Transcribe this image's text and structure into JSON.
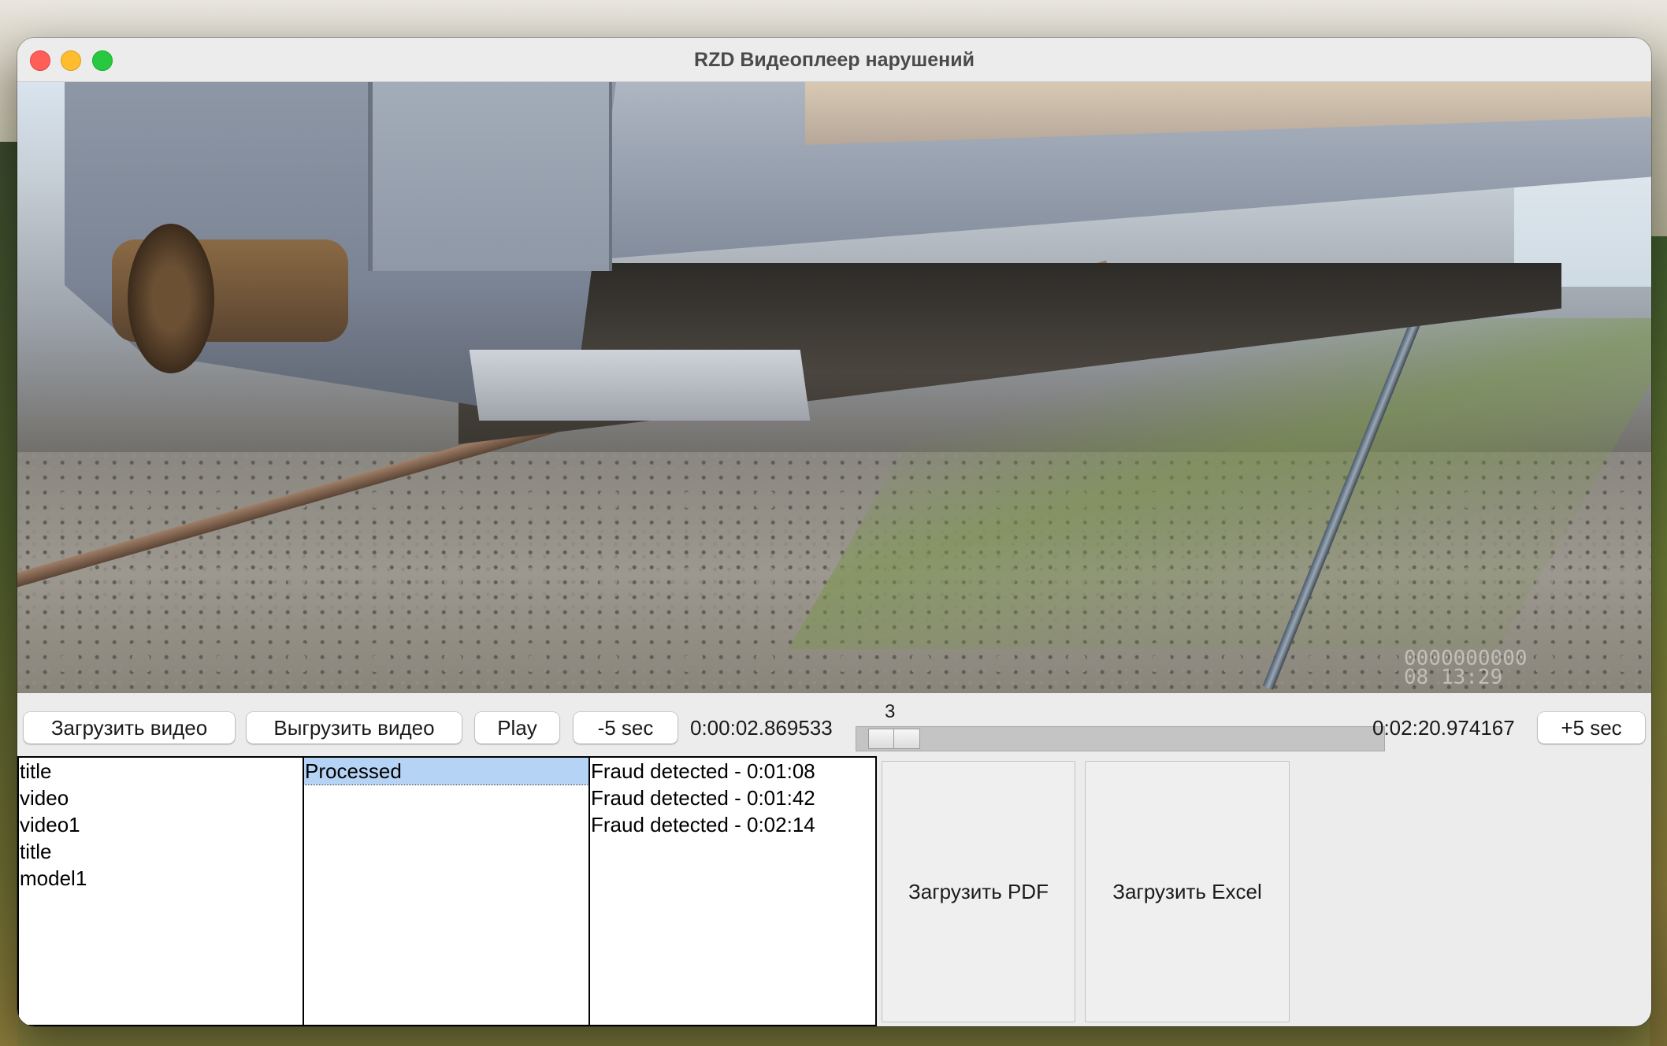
{
  "window": {
    "title": "RZD Видеоплеер нарушений"
  },
  "video": {
    "overlay_text_line1": "0000000000",
    "overlay_text_line2": "08 13:29"
  },
  "controls": {
    "load_video_label": "Загрузить видео",
    "unload_video_label": "Выгрузить видео",
    "play_label": "Play",
    "back_label": "-5 sec",
    "current_time": "0:00:02.869533",
    "slider_value": "3",
    "slider_fraction": 0.021,
    "total_time": "0:02:20.974167",
    "forward_label": "+5 sec"
  },
  "lists": {
    "files": [
      "title",
      "video",
      "video1",
      "title",
      "model1"
    ],
    "status": [
      "Processed"
    ],
    "status_selected_index": 0,
    "events": [
      "Fraud detected - 0:01:08",
      "Fraud detected - 0:01:42",
      "Fraud detected - 0:02:14"
    ]
  },
  "actions": {
    "pdf_label": "Загрузить PDF",
    "excel_label": "Загрузить Excel"
  }
}
